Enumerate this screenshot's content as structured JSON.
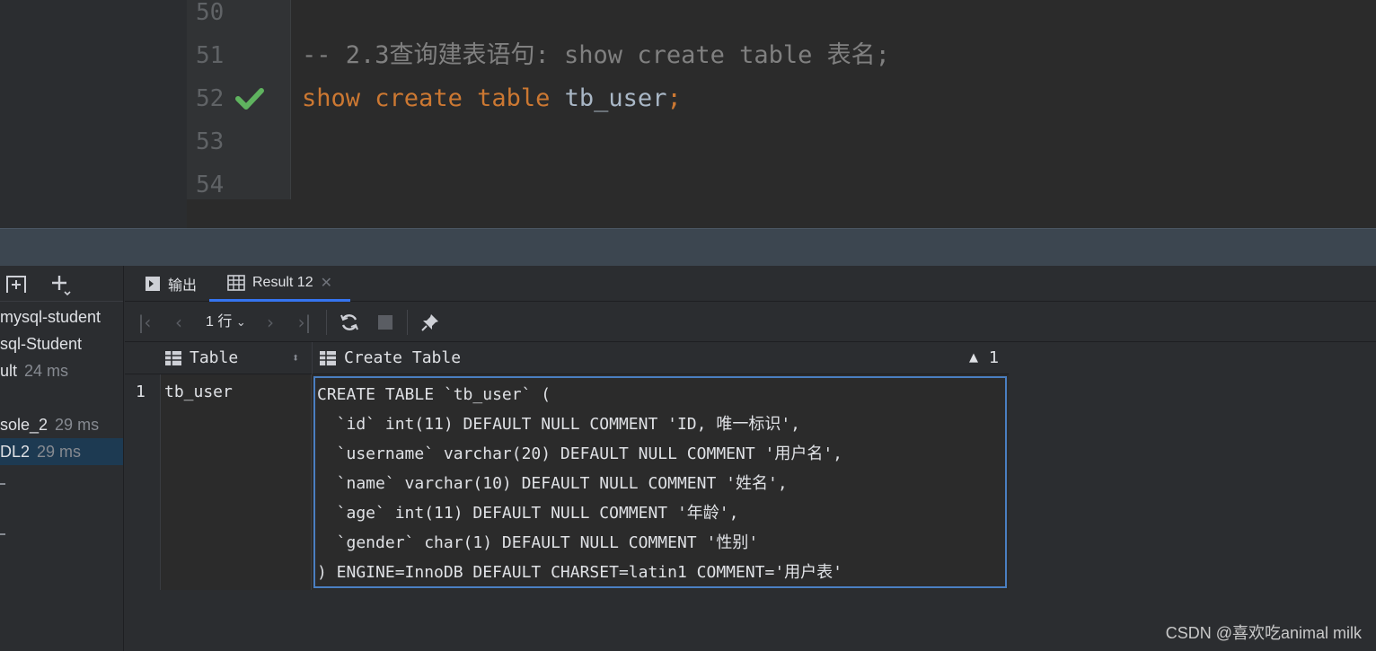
{
  "editor": {
    "lines": [
      {
        "num": "50",
        "text": ""
      },
      {
        "num": "51",
        "comment": "-- 2.3查询建表语句: show create table 表名;"
      },
      {
        "num": "52",
        "kw1": "show",
        "kw2": "create",
        "kw3": "table",
        "ident": "tb_user",
        "semi": ";"
      },
      {
        "num": "53",
        "text": ""
      },
      {
        "num": "54",
        "text": ""
      }
    ]
  },
  "services": {
    "items": [
      {
        "label": "mysql-student",
        "time": ""
      },
      {
        "label": "sql-Student",
        "time": ""
      },
      {
        "label": "ult",
        "time": "24 ms"
      },
      {
        "label": "sole_2",
        "time": "29 ms"
      },
      {
        "label": "DL2",
        "time": "29 ms"
      }
    ]
  },
  "results": {
    "tabs": [
      {
        "label": "输出"
      },
      {
        "label": "Result 12"
      }
    ],
    "rows_label": "1 行",
    "columns": [
      "Table",
      "Create Table"
    ],
    "sort_indicator": "1",
    "row_number": "1",
    "table_value": "tb_user",
    "ddl_lines": [
      "CREATE TABLE `tb_user` (",
      "  `id` int(11) DEFAULT NULL COMMENT 'ID, 唯一标识',",
      "  `username` varchar(20) DEFAULT NULL COMMENT '用户名',",
      "  `name` varchar(10) DEFAULT NULL COMMENT '姓名',",
      "  `age` int(11) DEFAULT NULL COMMENT '年龄',",
      "  `gender` char(1) DEFAULT NULL COMMENT '性别'",
      ") ENGINE=InnoDB DEFAULT CHARSET=latin1 COMMENT='用户表'"
    ]
  },
  "watermark": "CSDN @喜欢吃animal milk",
  "colors": {
    "keyword": "#cc7832",
    "comment": "#808080",
    "check": "#5fb35f",
    "selection": "#4a7fc1"
  }
}
